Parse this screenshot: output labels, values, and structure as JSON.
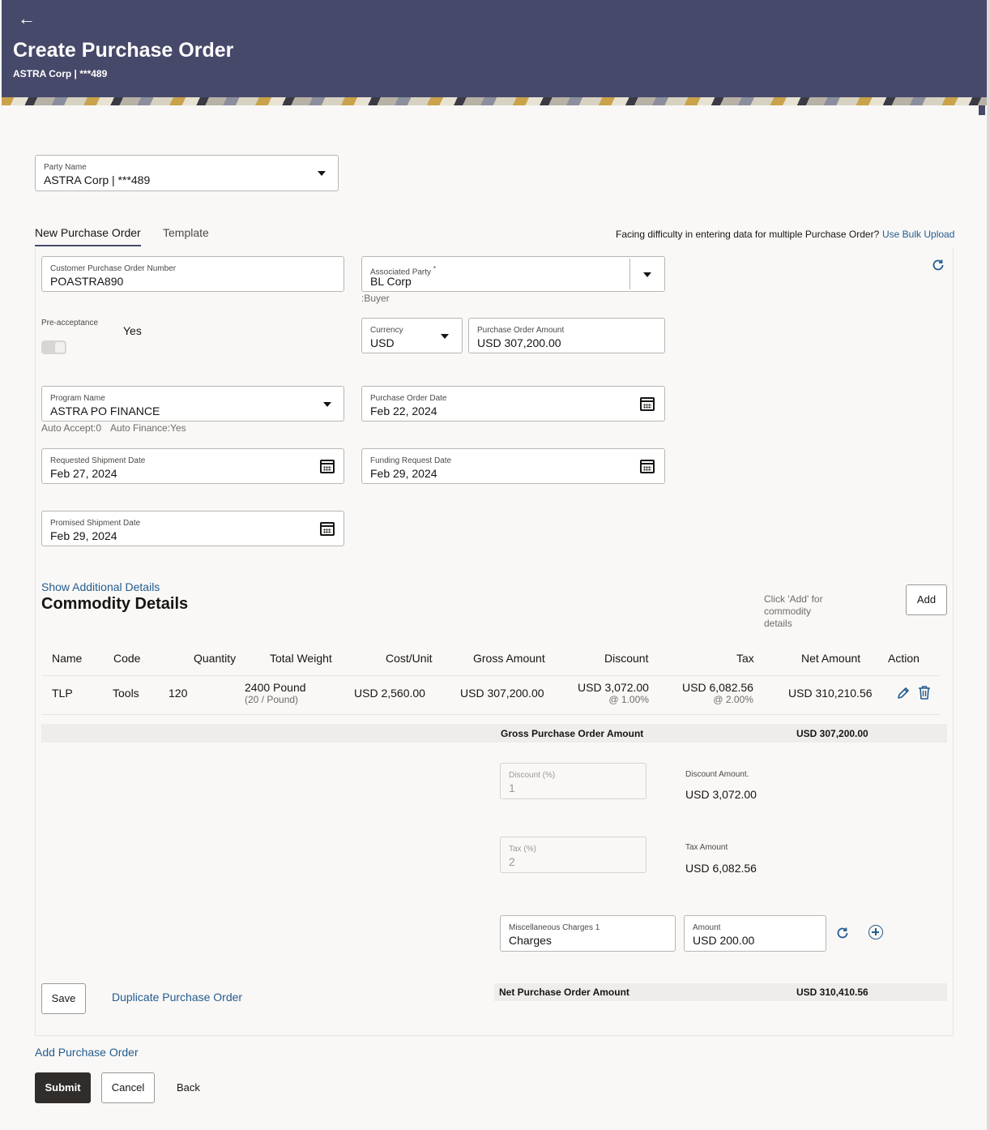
{
  "header": {
    "back": "←",
    "title": "Create Purchase Order",
    "subtitle": "ASTRA Corp | ***489"
  },
  "party": {
    "label": "Party Name",
    "value": "ASTRA Corp | ***489"
  },
  "tabs": [
    {
      "label": "New Purchase Order"
    },
    {
      "label": "Template"
    }
  ],
  "bulk": {
    "text": "Facing difficulty in entering data for multiple Purchase Order?",
    "link": "Use Bulk Upload"
  },
  "form": {
    "customer_po": {
      "label": "Customer Purchase Order Number",
      "value": "POASTRA890"
    },
    "associated_party": {
      "label": "Associated Party",
      "required": "*",
      "value": "BL Corp",
      "role": ":Buyer"
    },
    "pre_acceptance": {
      "label": "Pre-acceptance",
      "value": "Yes"
    },
    "currency": {
      "label": "Currency",
      "value": "USD"
    },
    "po_amount": {
      "label": "Purchase Order Amount",
      "value": "USD 307,200.00"
    },
    "program": {
      "label": "Program Name",
      "value": "ASTRA PO FINANCE",
      "auto_accept": "Auto Accept:0",
      "auto_finance": "Auto Finance:Yes"
    },
    "po_date": {
      "label": "Purchase Order Date",
      "value": "Feb 22, 2024"
    },
    "req_ship": {
      "label": "Requested Shipment Date",
      "value": "Feb 27, 2024"
    },
    "funding": {
      "label": "Funding Request Date",
      "value": "Feb 29, 2024"
    },
    "promised_ship": {
      "label": "Promised Shipment Date",
      "value": "Feb 29, 2024"
    }
  },
  "additional_link": "Show Additional Details",
  "commodity": {
    "title": "Commodity Details",
    "hint": "Click 'Add' for commodity details",
    "add_label": "Add",
    "columns": [
      "Name",
      "Code",
      "Quantity",
      "Total Weight",
      "Cost/Unit",
      "Gross Amount",
      "Discount",
      "Tax",
      "Net Amount",
      "Action"
    ],
    "row": {
      "name": "TLP",
      "code": "Tools",
      "quantity": "120",
      "weight": "2400 Pound",
      "weight_sub": "(20 / Pound)",
      "cost": "USD 2,560.00",
      "gross": "USD 307,200.00",
      "discount": "USD 3,072.00",
      "discount_sub": "@ 1.00%",
      "tax": "USD 6,082.56",
      "tax_sub": "@ 2.00%",
      "net": "USD 310,210.56"
    }
  },
  "summary": {
    "gross_label": "Gross Purchase Order Amount",
    "gross_value": "USD 307,200.00",
    "discount_pct_label": "Discount (%)",
    "discount_pct_value": "1",
    "discount_amount_label": "Discount Amount.",
    "discount_amount_value": "USD 3,072.00",
    "tax_pct_label": "Tax (%)",
    "tax_pct_value": "2",
    "tax_amount_label": "Tax Amount",
    "tax_amount_value": "USD 6,082.56",
    "misc_label": "Miscellaneous Charges 1",
    "misc_value": "Charges",
    "amount_label": "Amount",
    "amount_value": "USD 200.00",
    "net_label": "Net Purchase Order Amount",
    "net_value": "USD 310,410.56"
  },
  "actions": {
    "save": "Save",
    "duplicate": "Duplicate Purchase Order",
    "add_po": "Add Purchase Order",
    "submit": "Submit",
    "cancel": "Cancel",
    "back": "Back"
  },
  "colors": {
    "header": "#47496a",
    "link": "#245c8f",
    "primary_button": "#312d2a"
  }
}
